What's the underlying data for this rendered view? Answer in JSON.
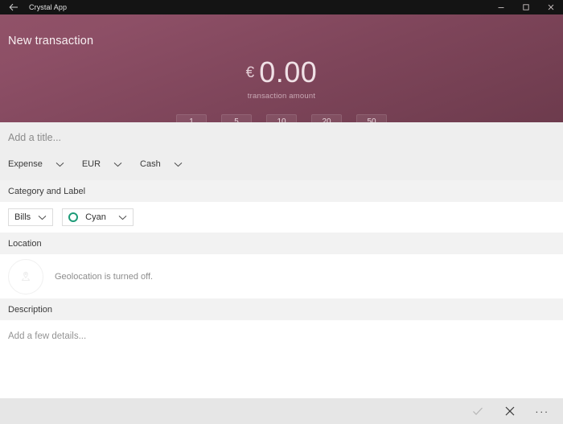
{
  "titlebar": {
    "back_icon": "back-arrow-icon",
    "app_title": "Crystal App",
    "minimize_label": "–",
    "maximize_label": "□",
    "close_label": "✕"
  },
  "header": {
    "page_title": "New transaction",
    "currency_symbol": "€",
    "amount": "0.00",
    "amount_caption": "transaction amount",
    "quick_amounts": [
      "1",
      "5",
      "10",
      "20",
      "50"
    ],
    "gradient_top": "#915268",
    "gradient_bottom": "#6d3b4d"
  },
  "form": {
    "title_placeholder": "Add a title...",
    "type_value": "Expense",
    "currency_value": "EUR",
    "payment_value": "Cash"
  },
  "category_section": {
    "heading": "Category and Label",
    "category_value": "Bills",
    "label_value": "Cyan",
    "label_color": "#1d9b78"
  },
  "location_section": {
    "heading": "Location",
    "status_text": "Geolocation is turned off.",
    "avatar_icon": "map-pin-icon"
  },
  "description_section": {
    "heading": "Description",
    "placeholder": "Add a few details..."
  },
  "commandbar": {
    "accept_label": "accept-check-icon",
    "cancel_label": "cancel-x-icon",
    "more_label": "···"
  }
}
